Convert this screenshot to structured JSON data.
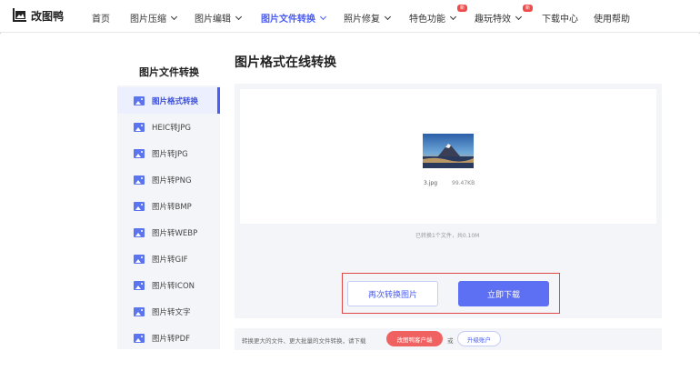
{
  "brand": {
    "name": "改图鸭",
    "logo_icon": "image-frame-icon",
    "accent": "#4a5df5"
  },
  "nav": {
    "items": [
      {
        "label": "首页"
      },
      {
        "label": "图片压缩"
      },
      {
        "label": "图片编辑"
      },
      {
        "label": "图片文件转换",
        "active": true
      },
      {
        "label": "照片修复"
      },
      {
        "label": "特色功能",
        "badge": "新"
      },
      {
        "label": "趣玩特效",
        "badge": "新"
      },
      {
        "label": "下载中心"
      },
      {
        "label": "使用帮助"
      }
    ]
  },
  "sidebar": {
    "title": "图片文件转换",
    "items": [
      {
        "label": "图片格式转换",
        "active": true
      },
      {
        "label": "HEIC转JPG"
      },
      {
        "label": "图片转JPG"
      },
      {
        "label": "图片转PNG"
      },
      {
        "label": "图片转BMP"
      },
      {
        "label": "图片转WEBP"
      },
      {
        "label": "图片转GIF"
      },
      {
        "label": "图片转ICON"
      },
      {
        "label": "图片转文字"
      },
      {
        "label": "图片转PDF"
      }
    ]
  },
  "main": {
    "title": "图片格式在线转换",
    "file": {
      "name": "3.jpg",
      "size": "99.47KB"
    },
    "convert_info": "已转换1个文件，共0.10M",
    "buttons": {
      "again": "再次转换图片",
      "download": "立即下载"
    }
  },
  "bottom": {
    "text": "转换更大的文件、更大批量的文件转换，请下载",
    "client_button": "改图鸭客户端",
    "or_text": "或",
    "upgrade_button": "升级账户"
  },
  "colors": {
    "accent": "#4a5df5",
    "download_button": "#5d6ff3",
    "client_button": "#f06262",
    "highlight_border": "#e04848"
  }
}
